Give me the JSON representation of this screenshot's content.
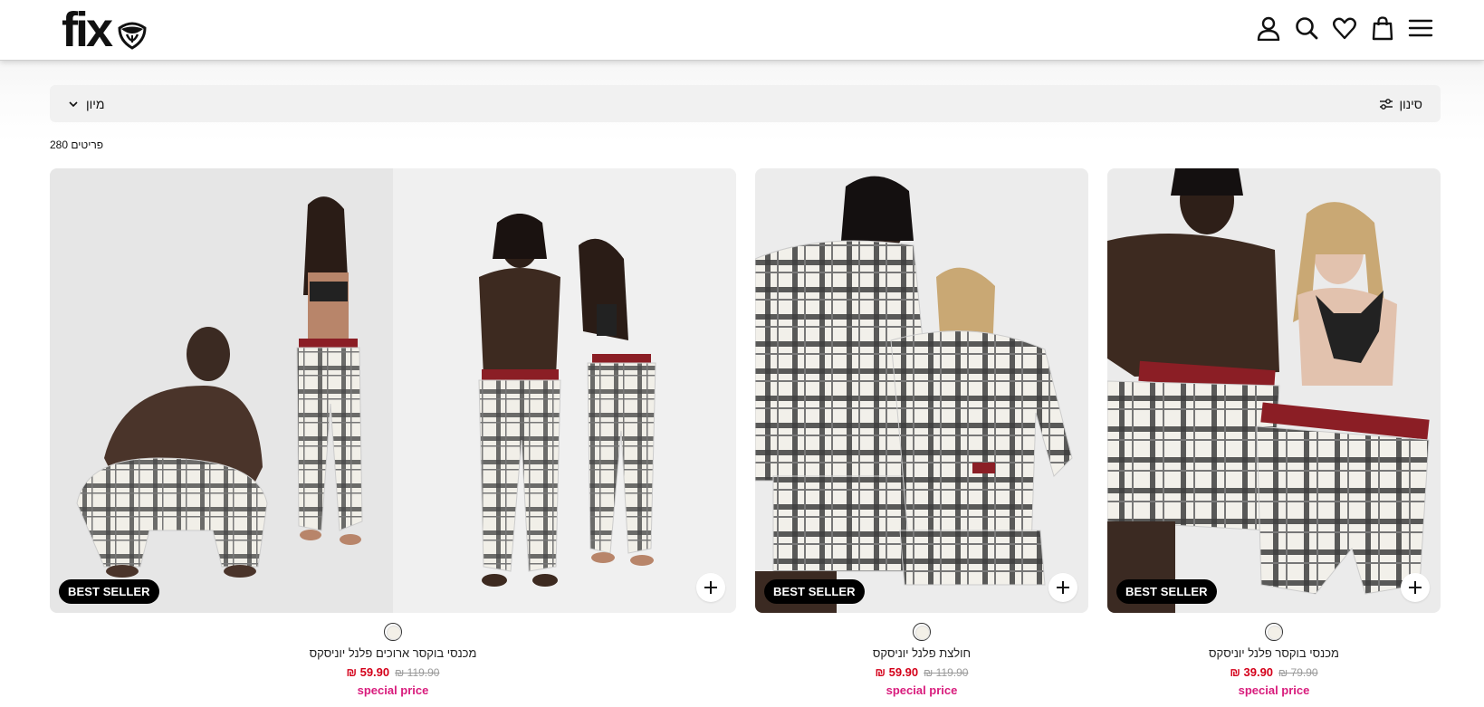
{
  "brand": {
    "logo_text": "fix"
  },
  "header": {
    "icons": [
      "user-icon",
      "search-icon",
      "heart-icon",
      "bag-icon",
      "menu-icon"
    ]
  },
  "toolbar": {
    "sort_label": "מיון",
    "filter_label": "סינון"
  },
  "results": {
    "count_label": "280 פריטים"
  },
  "products": [
    {
      "name": "מכנסי בוקסר ארוכים פלנל יוניסקס",
      "badge": "BEST SELLER",
      "price": "₪ 59.90",
      "old_price": "₪ 119.90",
      "promo": "special price"
    },
    {
      "name": "חולצת פלנל יוניסקס",
      "badge": "BEST SELLER",
      "price": "₪ 59.90",
      "old_price": "₪ 119.90",
      "promo": "special price"
    },
    {
      "name": "מכנסי בוקסר פלנל יוניסקס",
      "badge": "BEST SELLER",
      "price": "₪ 39.90",
      "old_price": "₪ 79.90",
      "promo": "special price"
    }
  ],
  "colors": {
    "price": "#d4001a",
    "promo": "#d81b7c",
    "badge_bg": "#000000",
    "toolbar_bg": "#f1f1f1"
  }
}
